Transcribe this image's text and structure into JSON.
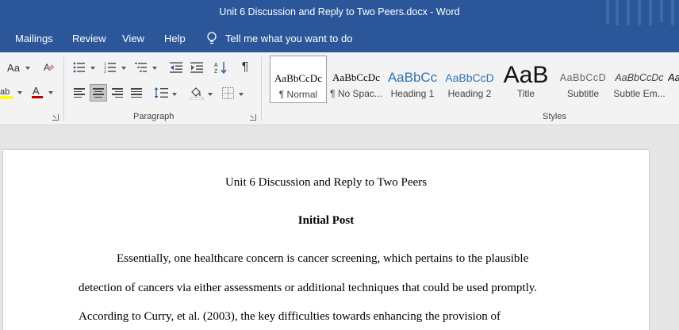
{
  "window": {
    "title": "Unit 6 Discussion and Reply to Two Peers.docx  -  Word"
  },
  "tabs": [
    "Mailings",
    "Review",
    "View",
    "Help"
  ],
  "tell_me": "Tell me what you want to do",
  "ribbon": {
    "paragraph_label": "Paragraph",
    "styles_label": "Styles",
    "font_case_label": "Aa",
    "styles": [
      {
        "sample": "AaBbCcDc",
        "name": "¶ Normal"
      },
      {
        "sample": "AaBbCcDc",
        "name": "¶ No Spac..."
      },
      {
        "sample": "AaBbCc",
        "name": "Heading 1"
      },
      {
        "sample": "AaBbCcD",
        "name": "Heading 2"
      },
      {
        "sample": "AaB",
        "name": "Title"
      },
      {
        "sample": "AaBbCcD",
        "name": "Subtitle"
      },
      {
        "sample": "AaBbCcDc",
        "name": "Subtle Em..."
      },
      {
        "sample": "Aa",
        "name": ""
      }
    ]
  },
  "document": {
    "title": "Unit 6 Discussion and Reply to Two Peers",
    "heading": "Initial Post",
    "lines": [
      "Essentially, one healthcare concern is cancer screening, which pertains to the plausible",
      "detection of cancers via either assessments or additional techniques that could be used promptly.",
      "According to Curry, et al. (2003), the key difficulties towards enhancing the provision of"
    ]
  },
  "colors": {
    "title_bar": "#2b579a",
    "heading1": "#2e74b5",
    "font_color_underline": "#c00000",
    "highlight": "#ffff00"
  }
}
